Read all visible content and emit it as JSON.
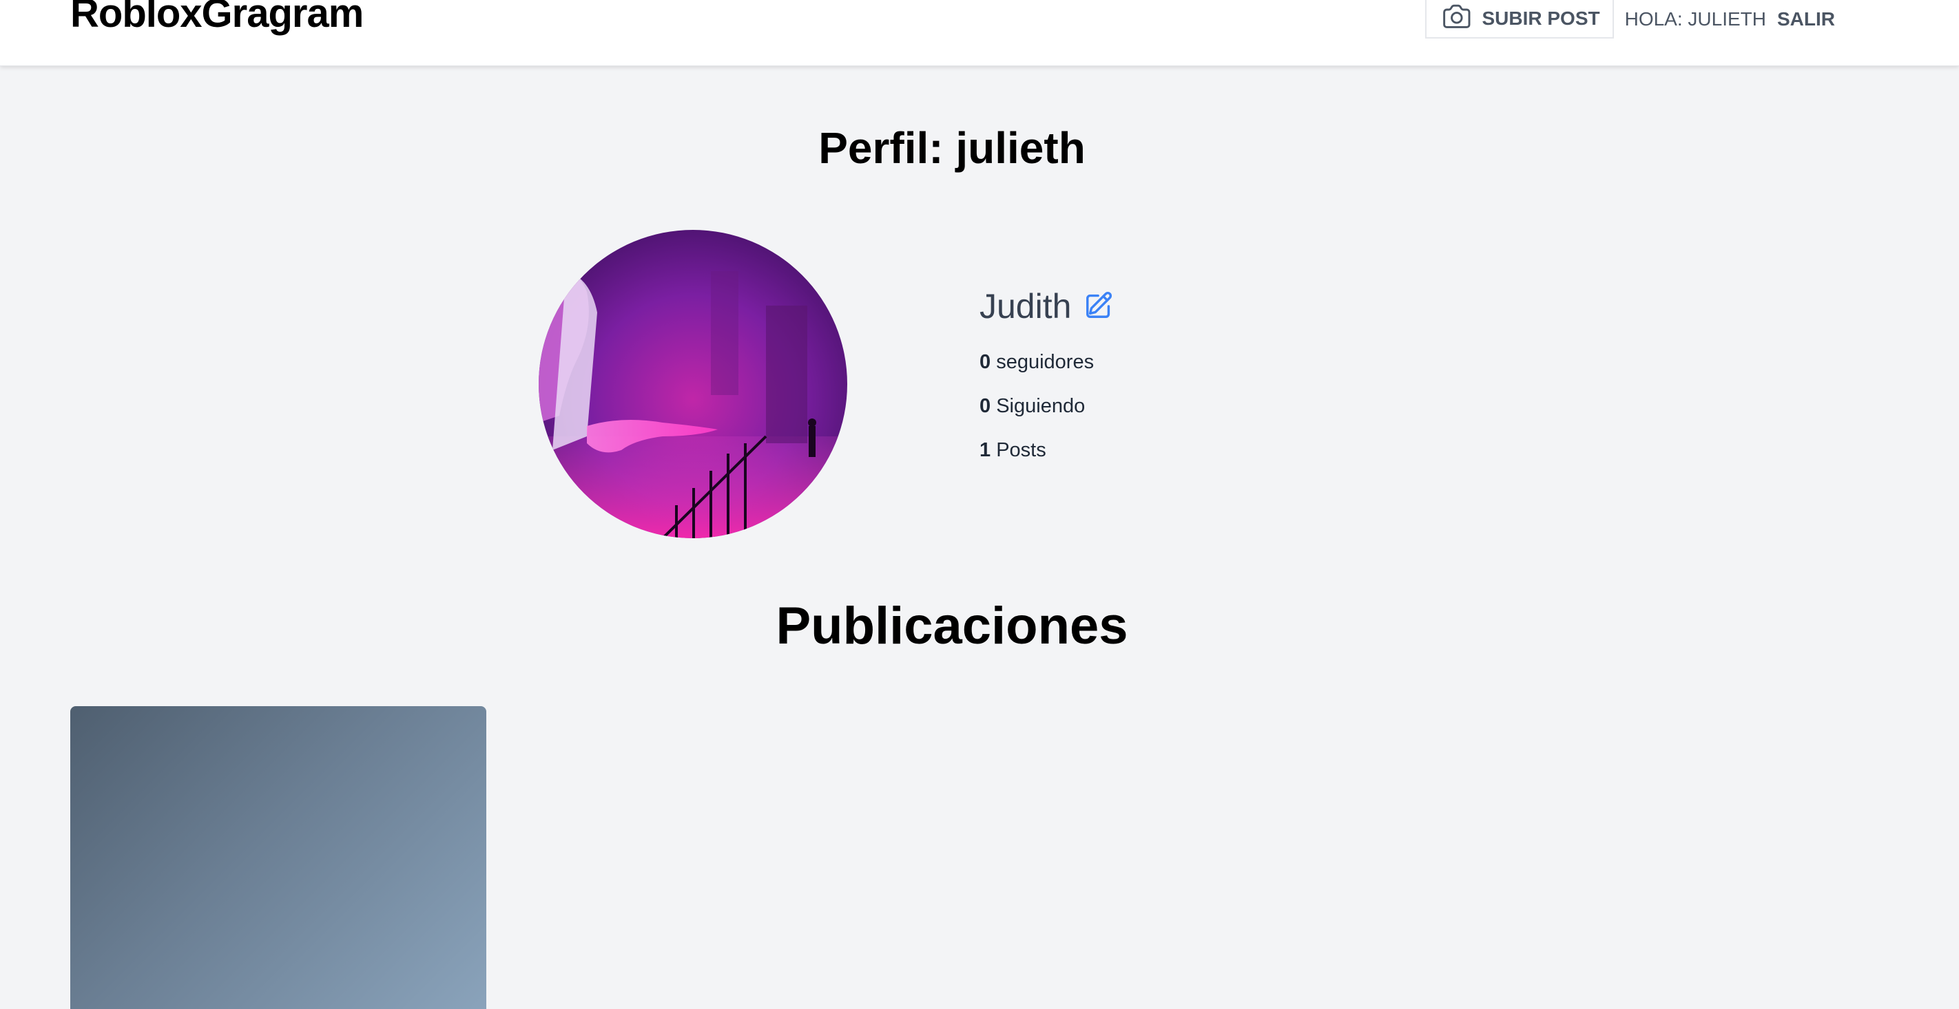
{
  "header": {
    "logo": "RobloxGragram",
    "upload_label": "SUBIR POST",
    "greeting": "HOLA: JULIETH",
    "logout_label": "SALIR",
    "upload_icon": "camera-icon"
  },
  "profile": {
    "title": "Perfil: julieth",
    "display_name": "Judith",
    "edit_icon": "pencil-square-icon",
    "stats": {
      "followers_count": "0",
      "followers_label": "seguidores",
      "following_count": "0",
      "following_label": "Siguiendo",
      "posts_count": "1",
      "posts_label": "Posts"
    }
  },
  "posts": {
    "title": "Publicaciones"
  },
  "colors": {
    "background": "#f3f4f6",
    "header_bg": "#ffffff",
    "edit_icon": "#3b82f6",
    "text_muted": "#4b5563"
  }
}
